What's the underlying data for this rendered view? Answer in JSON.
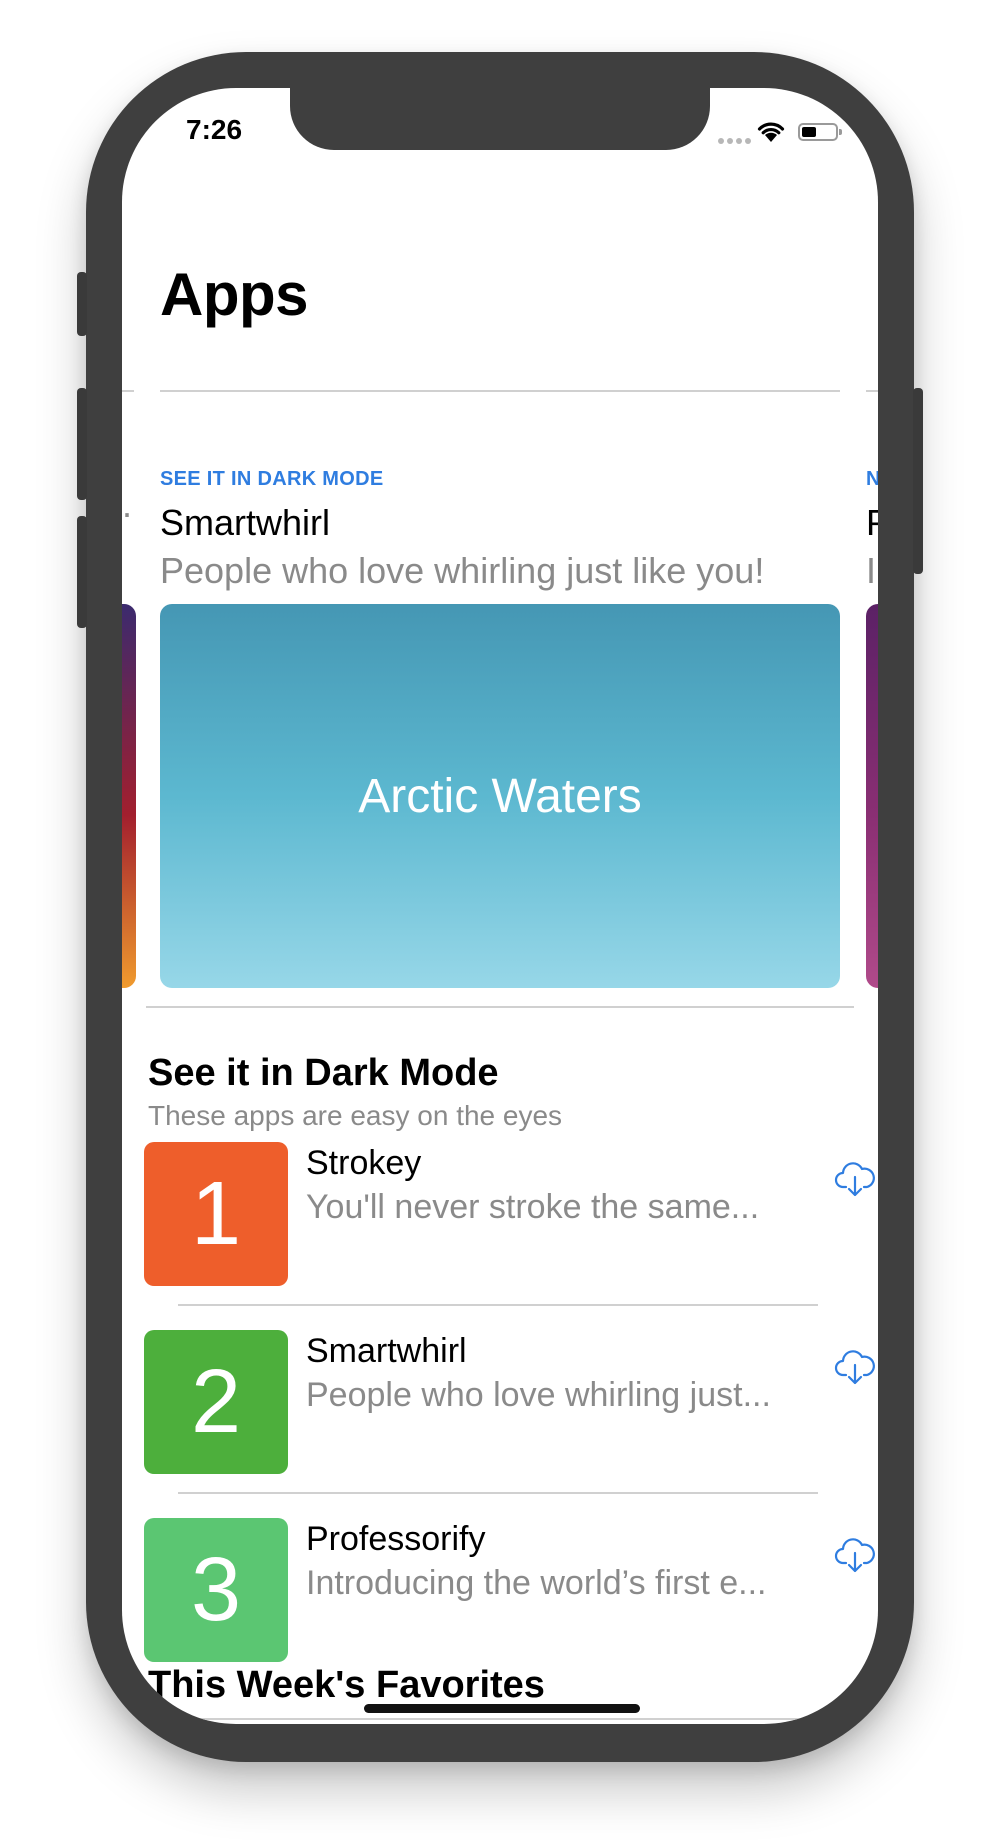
{
  "status_bar": {
    "time": "7:26"
  },
  "page": {
    "title": "Apps"
  },
  "featured": {
    "tag": "SEE IT IN DARK MODE",
    "app_name": "Smartwhirl",
    "description": "People who love whirling just like you!",
    "card_title": "Arctic Waters",
    "gradient": [
      "#4597b4",
      "#5cb8d0",
      "#97d7e8"
    ]
  },
  "peek": {
    "left_dot": ".",
    "right_tag": "N",
    "right_name": "P",
    "right_desc": "I"
  },
  "dark_mode_section": {
    "title": "See it in Dark Mode",
    "subtitle": "These apps are easy on the eyes",
    "apps": [
      {
        "rank": "1",
        "name": "Strokey",
        "description": "You'll never stroke the same...",
        "color": "#ee5e2b",
        "icon": "download-cloud-icon"
      },
      {
        "rank": "2",
        "name": "Smartwhirl",
        "description": "People who love whirling just...",
        "color": "#4daf3c",
        "icon": "download-cloud-icon"
      },
      {
        "rank": "3",
        "name": "Professorify",
        "description": "Introducing the world’s first e...",
        "color": "#5bc672",
        "icon": "download-cloud-icon"
      }
    ]
  },
  "favorites_section": {
    "title": "This Week's Favorites"
  },
  "colors": {
    "accent": "#2f7de0",
    "device_frame": "#3f3f3f"
  }
}
